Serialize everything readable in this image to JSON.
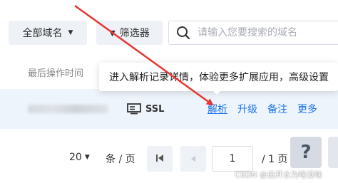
{
  "filters": {
    "domain_select_label": "全部域名",
    "filter_button_label": "筛选器",
    "search_placeholder": "请输入您要搜索的域名"
  },
  "table": {
    "column_header": "最后操作时间",
    "row": {
      "ssl_label": "SSL",
      "actions": {
        "resolve": "解析",
        "upgrade": "升级",
        "remark": "备注",
        "more": "更多"
      }
    }
  },
  "tooltip": {
    "text": "进入解析记录详情，体验更多扩展应用，高级设置"
  },
  "pagination": {
    "page_size": "20",
    "per_page_label": "条 / 页",
    "current_page": "1",
    "total_label": "/ 1 页"
  },
  "help": {
    "label": "?"
  },
  "watermark": "CSDN @白开水为啥没味",
  "colors": {
    "link": "#1a73e8",
    "annotation_arrow": "#e53935",
    "row_highlight": "#eef4fb"
  },
  "icons": {
    "domain_caret": "caret-down",
    "filter": "funnel",
    "search": "magnifier",
    "ssl": "certificate",
    "first_page": "skip-first",
    "prev_page": "caret-left",
    "page_size_caret": "caret-down"
  }
}
